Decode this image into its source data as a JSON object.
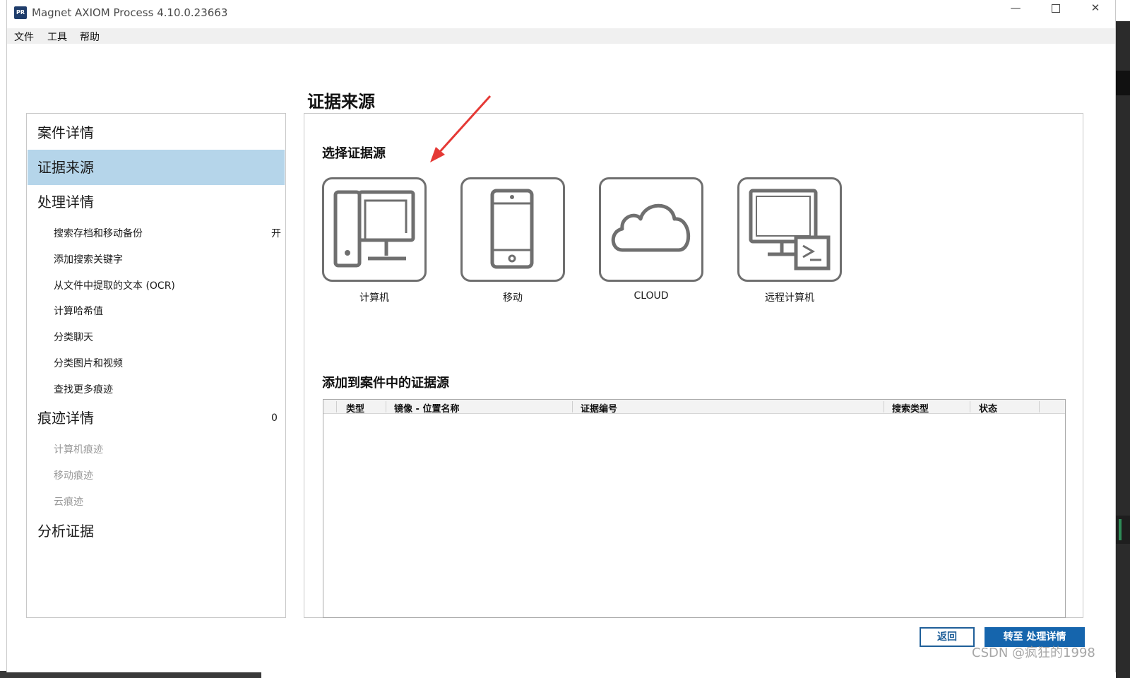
{
  "window": {
    "title": "Magnet AXIOM Process 4.10.0.23663",
    "icon_text": "PR",
    "controls": {
      "minimize": "—",
      "maximize": "",
      "close": "✕"
    }
  },
  "menu": [
    "文件",
    "工具",
    "帮助"
  ],
  "nav": {
    "sections": {
      "case_details": "案件详情",
      "evidence_sources": "证据来源",
      "processing_details": "处理详情",
      "artifact_details": "痕迹详情",
      "analyze_evidence": "分析证据"
    },
    "processing_items": [
      {
        "label": "搜索存档和移动备份",
        "value": "开"
      },
      {
        "label": "添加搜索关键字"
      },
      {
        "label": "从文件中提取的文本 (OCR)"
      },
      {
        "label": "计算哈希值"
      },
      {
        "label": "分类聊天"
      },
      {
        "label": "分类图片和视频"
      },
      {
        "label": "查找更多痕迹"
      }
    ],
    "artifact_count": "0",
    "artifact_items": [
      "计算机痕迹",
      "移动痕迹",
      "云痕迹"
    ]
  },
  "main": {
    "page_title": "证据来源",
    "select_heading": "选择证据源",
    "sources": [
      {
        "label": "计算机",
        "icon": "computer-icon"
      },
      {
        "label": "移动",
        "icon": "mobile-phone-icon"
      },
      {
        "label": "CLOUD",
        "icon": "cloud-icon"
      },
      {
        "label": "远程计算机",
        "icon": "remote-computer-icon"
      }
    ],
    "added_heading": "添加到案件中的证据源",
    "table_columns": [
      "类型",
      "镜像 - 位置名称",
      "证据编号",
      "搜索类型",
      "状态"
    ],
    "table_rows": []
  },
  "buttons": {
    "back": "返回",
    "next": "转至 处理详情"
  },
  "watermark": "CSDN @疯狂的1998",
  "colors": {
    "nav_active": "#b5d5ea",
    "primary": "#1565ad",
    "annotation_arrow": "#e53935"
  }
}
